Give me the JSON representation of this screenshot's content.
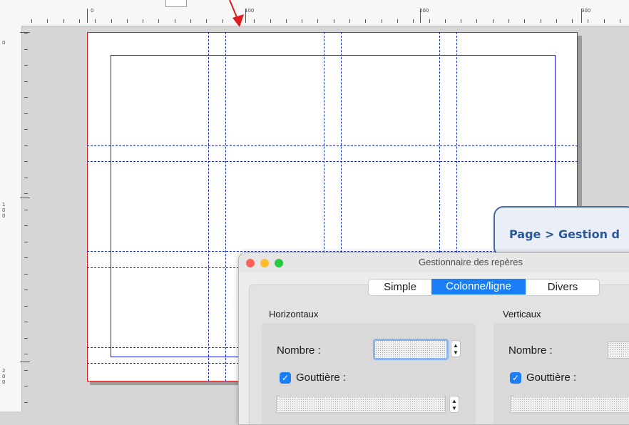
{
  "ruler": {
    "horizontal_labels": [
      "0",
      "100",
      "200",
      "300"
    ],
    "vertical_labels": [
      "1\n0\n0",
      "2\n0\n0"
    ],
    "origin_mark": "0"
  },
  "callout": {
    "text": "Page > Gestion d"
  },
  "dialog": {
    "title": "Gestionnaire des repères",
    "tabs": [
      "Simple",
      "Colonne/ligne",
      "Divers"
    ],
    "selected_tab": "Colonne/ligne",
    "horizontal": {
      "title": "Horizontaux",
      "count_label": "Nombre :",
      "gutter_label": "Gouttière :",
      "gutter_checked": true
    },
    "vertical": {
      "title": "Verticaux",
      "count_label": "Nombre :",
      "gutter_label": "Gouttière :",
      "gutter_checked": true
    }
  },
  "colors": {
    "page_border": "#e11b1b",
    "margin": "#1a1ae0",
    "guides": "#1a2fb0",
    "accent": "#1a7ef7",
    "callout_text": "#2b5797"
  }
}
